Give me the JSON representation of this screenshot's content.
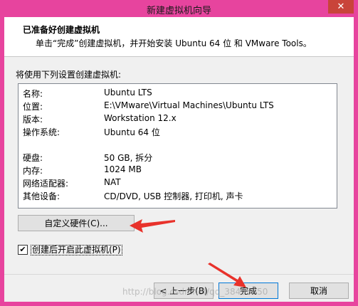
{
  "window": {
    "title": "新建虚拟机向导",
    "close": "✕"
  },
  "header": {
    "title": "已准备好创建虚拟机",
    "subtitle": "单击“完成”创建虚拟机，并开始安装 Ubuntu 64 位 和 VMware Tools。"
  },
  "intro": "将使用下列设置创建虚拟机:",
  "summary": [
    {
      "key": "名称:",
      "value": "Ubuntu LTS"
    },
    {
      "key": "位置:",
      "value": "E:\\VMware\\Virtual Machines\\Ubuntu LTS"
    },
    {
      "key": "版本:",
      "value": "Workstation 12.x"
    },
    {
      "key": "操作系统:",
      "value": "Ubuntu 64 位"
    },
    {
      "key": "硬盘:",
      "value": "50 GB, 拆分"
    },
    {
      "key": "内存:",
      "value": "1024 MB"
    },
    {
      "key": "网络适配器:",
      "value": "NAT"
    },
    {
      "key": "其他设备:",
      "value": "CD/DVD, USB 控制器, 打印机, 声卡"
    }
  ],
  "customize_button": "自定义硬件(C)...",
  "power_on_checkbox": {
    "label": "创建后开启此虚拟机(P)",
    "checked": true,
    "mark": "✔"
  },
  "buttons": {
    "back": "< 上一步(B)",
    "finish": "完成",
    "cancel": "取消"
  },
  "watermark": "http://blog.csdn.net/qq_38495950",
  "colors": {
    "frame": "#e7449e",
    "close": "#c9443a",
    "annotation_arrow": "#e8322b"
  }
}
